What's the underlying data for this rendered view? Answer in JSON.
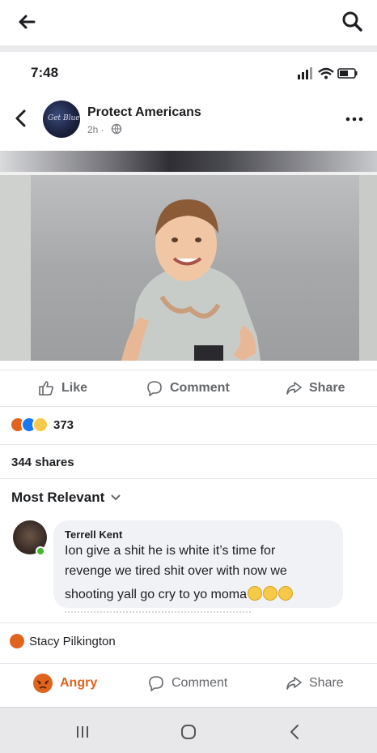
{
  "viewer": {
    "back_icon": "arrow-left-icon",
    "search_icon": "search-icon"
  },
  "status_bar": {
    "time": "7:48",
    "icons": [
      "signal-icon",
      "wifi-icon",
      "battery-icon"
    ]
  },
  "post": {
    "page_name": "Protect Americans",
    "time": "2h ·",
    "privacy_icon": "globe-icon",
    "avatar_text": "Get Blue",
    "actions": {
      "like": "Like",
      "comment": "Comment",
      "share": "Share"
    },
    "reactions": {
      "types": [
        "angry",
        "like",
        "sad"
      ],
      "count": "373"
    },
    "shares": "344 shares"
  },
  "comments": {
    "sort_label": "Most Relevant",
    "items": [
      {
        "author": "Terrell Kent",
        "line1": "Ion give a shit he is white it’s time for",
        "line2": "revenge we tired shit over with now we",
        "line3": "shooting yall go cry to yo moma",
        "emoji_count": 3,
        "emoji": "laughing-emoji"
      }
    ]
  },
  "reactor": {
    "name": "Stacy Pilkington",
    "reaction": "angry"
  },
  "bottom_actions": {
    "angry": "Angry",
    "comment": "Comment",
    "share": "Share"
  },
  "colors": {
    "angry": "#e0641e",
    "like_blue": "#1877f2",
    "sad_yellow": "#f7c948",
    "text_muted": "#65676b"
  }
}
